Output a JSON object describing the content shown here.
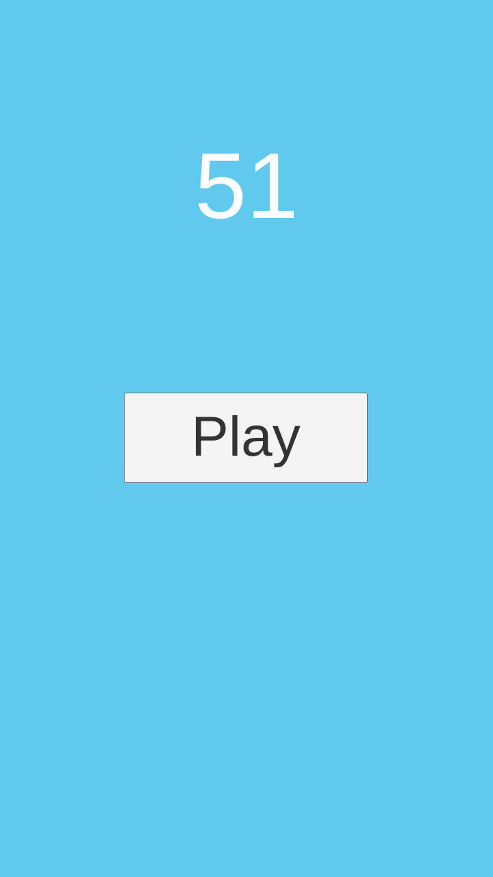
{
  "game": {
    "score": "51",
    "play_label": "Play"
  },
  "colors": {
    "background": "#62C9EE",
    "score_text": "#FFFFFF",
    "button_background": "#F4F4F4",
    "button_text": "#333333"
  }
}
